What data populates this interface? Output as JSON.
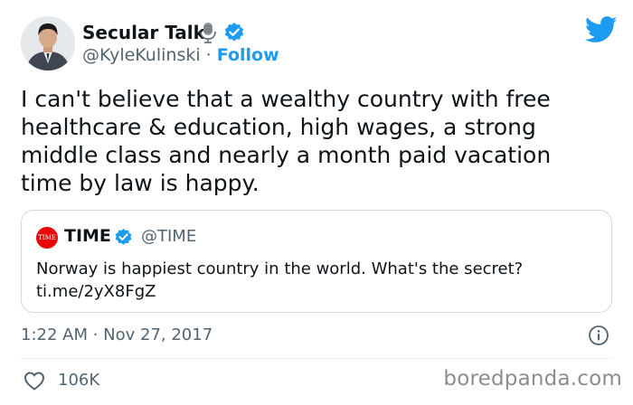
{
  "author": {
    "display_name": "Secular Talk",
    "handle": "@KyleKulinski",
    "separator": "·",
    "follow_label": "Follow"
  },
  "tweet": {
    "text": "I can't believe that a wealthy country with free\nhealthcare & education, high wages, a strong\nmiddle class and nearly a month paid vacation\ntime by law is happy."
  },
  "quote": {
    "logo_text": "TIME",
    "display_name": "TIME",
    "handle": "@TIME",
    "text": "Norway is happiest country in the world. What's the secret?\nti.me/2yX8FgZ"
  },
  "meta": {
    "timestamp": "1:22 AM · Nov 27, 2017",
    "like_count": "106K"
  },
  "watermark": "boredpanda.com",
  "icons": {
    "mic": "microphone-icon",
    "verified": "verified-badge-icon",
    "bird": "twitter-bird-icon",
    "info": "info-icon",
    "like": "heart-icon"
  },
  "colors": {
    "accent": "#1d9bf0",
    "text": "#0f1419",
    "muted": "#536471",
    "border": "#cfd9de",
    "time_brand": "#e90606"
  }
}
